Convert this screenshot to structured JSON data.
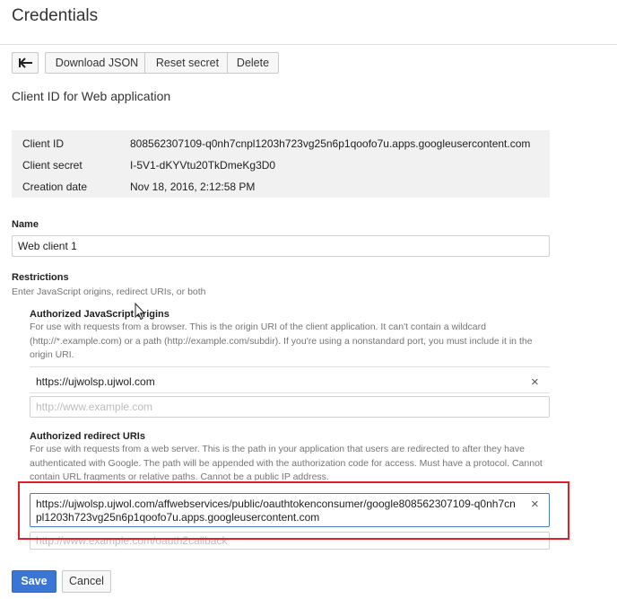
{
  "header": {
    "title": "Credentials"
  },
  "toolbar": {
    "back_icon": "back-arrow-icon",
    "download_label": "Download JSON",
    "reset_label": "Reset secret",
    "delete_label": "Delete"
  },
  "subtitle": "Client ID for Web application",
  "info": {
    "client_id_label": "Client ID",
    "client_id_value": "808562307109-q0nh7cnpl1203h723vg25n6p1qoofo7u.apps.googleusercontent.com",
    "client_secret_label": "Client secret",
    "client_secret_value": "I-5V1-dKYVtu20TkDmeKg3D0",
    "creation_date_label": "Creation date",
    "creation_date_value": "Nov 18, 2016, 2:12:58 PM"
  },
  "name": {
    "label": "Name",
    "value": "Web client 1"
  },
  "restrictions": {
    "label": "Restrictions",
    "description": "Enter JavaScript origins, redirect URIs, or both",
    "js_origins": {
      "label": "Authorized JavaScript origins",
      "help": "For use with requests from a browser. This is the origin URI of the client application. It can't contain a wildcard (http://*.example.com) or a path (http://example.com/subdir). If you're using a nonstandard port, you must include it in the origin URI.",
      "existing_uri": "https://ujwolsp.ujwol.com",
      "placeholder": "http://www.example.com"
    },
    "redirect_uris": {
      "label": "Authorized redirect URIs",
      "help": "For use with requests from a web server. This is the path in your application that users are redirected to after they have authenticated with Google. The path will be appended with the authorization code for access. Must have a protocol. Cannot contain URL fragments or relative paths. Cannot be a public IP address.",
      "value": "https://ujwolsp.ujwol.com/affwebservices/public/oauthtokenconsumer/google808562307109-q0nh7cnpl1203h723vg25n6p1qoofo7u.apps.googleusercontent.com",
      "placeholder": "http://www.example.com/oauth2callback"
    }
  },
  "actions": {
    "save_label": "Save",
    "cancel_label": "Cancel"
  },
  "icons": {
    "remove": "×"
  },
  "colors": {
    "primary": "#3a76d6",
    "highlight": "#e0202a"
  }
}
